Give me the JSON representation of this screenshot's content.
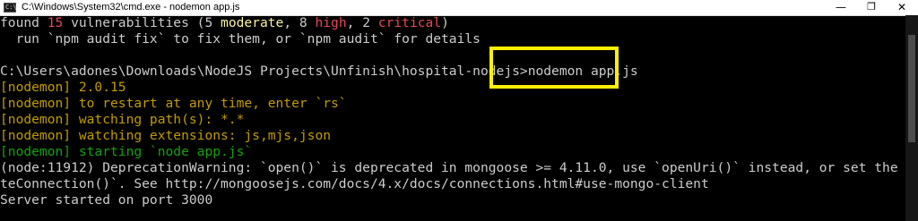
{
  "window": {
    "title": "C:\\Windows\\System32\\cmd.exe - nodemon  app.js",
    "icon_text": "C:\\",
    "minimize_glyph": "—",
    "maximize_glyph": "❐",
    "close_glyph": "✕"
  },
  "console": {
    "audit": {
      "prefix": "found ",
      "count": "15",
      "mid1": " vulnerabilities (5 ",
      "moderate": "moderate",
      "mid2": ", 8 ",
      "high": "high",
      "mid3": ", 2 ",
      "critical": "critical",
      "suffix": ")"
    },
    "audit_hint": "  run `npm audit fix` to fix them, or `npm audit` for details",
    "prompt": "C:\\Users\\adones\\Downloads\\NodeJS Projects\\Unfinish\\hospital-nodejs>",
    "command": "nodemon app.js",
    "nodemon_lines": [
      "[nodemon] 2.0.15",
      "[nodemon] to restart at any time, enter `rs`",
      "[nodemon] watching path(s): *.*",
      "[nodemon] watching extensions: js,mjs,json"
    ],
    "nodemon_starting": "[nodemon] starting `node app.js`",
    "deprecation_line1": "(node:11912) DeprecationWarning: `open()` is deprecated in mongoose >= 4.11.0, use `openUri()` instead, or set the `useMongo",
    "deprecation_line2": "teConnection()`. See http://mongoosejs.com/docs/4.x/docs/connections.html#use-mongo-client",
    "server_line": "Server started on port 3000"
  },
  "colors": {
    "background": "#000000",
    "text": "#cccccc",
    "red": "#e74856",
    "yellow": "#f9f1a5",
    "olive": "#c19c00",
    "green": "#13a10e",
    "highlight": "#ffef00"
  }
}
